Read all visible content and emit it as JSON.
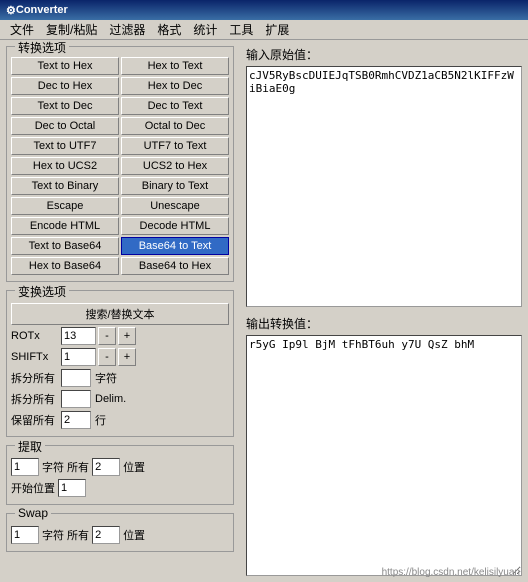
{
  "titleBar": {
    "title": "Converter",
    "icon": "⚙"
  },
  "menuBar": {
    "items": [
      "文件",
      "复制/粘贴",
      "过滤器",
      "格式",
      "统计",
      "工具",
      "扩展"
    ]
  },
  "leftPanel": {
    "conversionGroup": {
      "title": "转换选项",
      "buttons": [
        [
          "Text to Hex",
          "Hex to Text"
        ],
        [
          "Dec to Hex",
          "Hex to Dec"
        ],
        [
          "Text to Dec",
          "Dec to Text"
        ],
        [
          "Dec to Octal",
          "Octal to Dec"
        ],
        [
          "Text to UTF7",
          "UTF7 to Text"
        ],
        [
          "Hex to UCS2",
          "UCS2 to Hex"
        ],
        [
          "Text to Binary",
          "Binary to Text"
        ],
        [
          "Escape",
          "Unescape"
        ],
        [
          "Encode HTML",
          "Decode HTML"
        ],
        [
          "Text to Base64",
          "Base64 to Text"
        ],
        [
          "Hex to Base64",
          "Base64 to Hex"
        ]
      ],
      "highlightedBtn": "Base64 to Text"
    },
    "optionsGroup": {
      "title": "变换选项",
      "searchReplaceBtn": "搜索/替换文本",
      "rotRow": {
        "label": "ROTx",
        "value": "13",
        "minusBtn": "-",
        "plusBtn": "+"
      },
      "shiftRow": {
        "label": "SHIFTx",
        "value": "1",
        "minusBtn": "-",
        "plusBtn": "+"
      },
      "splitRows": [
        {
          "label": "拆分所有",
          "value": "",
          "unit": "字符"
        },
        {
          "label": "拆分所有",
          "value": "",
          "unit": "Delim."
        },
        {
          "label": "保留所有",
          "value": "2",
          "unit": "行"
        }
      ]
    },
    "extractSection": {
      "title": "提取",
      "rows": [
        {
          "val1": "1",
          "label1": "字符 所有",
          "val2": "2",
          "label2": "位置"
        },
        {
          "prefixLabel": "开始位置",
          "val": "1"
        }
      ]
    },
    "swapSection": {
      "title": "Swap",
      "rows": [
        {
          "val1": "1",
          "label1": "字符 所有",
          "val2": "2",
          "label2": "位置"
        }
      ]
    }
  },
  "rightPanel": {
    "inputLabel": "输入原始值：",
    "inputValue": "cJV5RyBscDUIEJqTSB0RmhCVDZ1aCB5N2lKIFFzWiBiaE0g",
    "outputLabel": "输出转换值：",
    "outputValue": "r5yG Ip9l BjM tFhBT6uh y7U QsZ bhM"
  },
  "watermark": "https://blog.csdn.net/kelisilyuan"
}
